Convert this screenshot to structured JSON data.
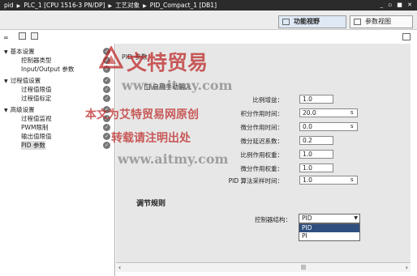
{
  "title_bar": {
    "breadcrumb": [
      "pid",
      "PLC_1 [CPU 1516-3 PN/DP]",
      "工艺对象",
      "PID_Compact_1 [DB1]"
    ],
    "window_controls": "_ ▫ ■ ✕"
  },
  "tabs": [
    {
      "label": "功能视野",
      "active": true
    },
    {
      "label": "参数视图",
      "active": false
    }
  ],
  "sidebar": {
    "items": [
      {
        "label": "基本设置",
        "group": true
      },
      {
        "label": "控制器类型",
        "group": false
      },
      {
        "label": "Input/Output 参数",
        "group": false
      },
      {
        "label": "过程值设置",
        "group": true
      },
      {
        "label": "过程值限值",
        "group": false
      },
      {
        "label": "过程值标定",
        "group": false
      },
      {
        "label": "高级设置",
        "group": true
      },
      {
        "label": "过程值监视",
        "group": false
      },
      {
        "label": "PWM限制",
        "group": false
      },
      {
        "label": "输出值限值",
        "group": false
      },
      {
        "label": "PID 参数",
        "group": false,
        "selected": true
      }
    ]
  },
  "main": {
    "section_title": "PID 参数",
    "manual_checkbox": "启用手动输入",
    "params": [
      {
        "label": "比例增益：",
        "value": "1.0",
        "unit": ""
      },
      {
        "label": "积分作用时间：",
        "value": "20.0",
        "unit": "s"
      },
      {
        "label": "微分作用时间：",
        "value": "0.0",
        "unit": "s"
      },
      {
        "label": "微分延迟系数：",
        "value": "0.2",
        "unit": ""
      },
      {
        "label": "比例作用权重：",
        "value": "1.0",
        "unit": ""
      },
      {
        "label": "微分作用权重：",
        "value": "1.0",
        "unit": ""
      },
      {
        "label": "PID 算法采样时间：",
        "value": "1.0",
        "unit": "s"
      }
    ],
    "rules_title": "调节规则",
    "controller_label": "控制器结构：",
    "controller_value": "PID",
    "dropdown_options": [
      "PID",
      "PI"
    ]
  },
  "watermarks": {
    "brand": "文特贸易",
    "url_1": "www.aitmy.com",
    "copyright": "本文为艾特贸易网原创",
    "notice": "转载请注明出处",
    "url_2": "www.aitmy.com"
  },
  "colors": {
    "title_bar": "#2b2b2b",
    "panel_bg": "#e7e7e7",
    "selection": "#2f4f7f",
    "watermark_red": "#be2828"
  }
}
